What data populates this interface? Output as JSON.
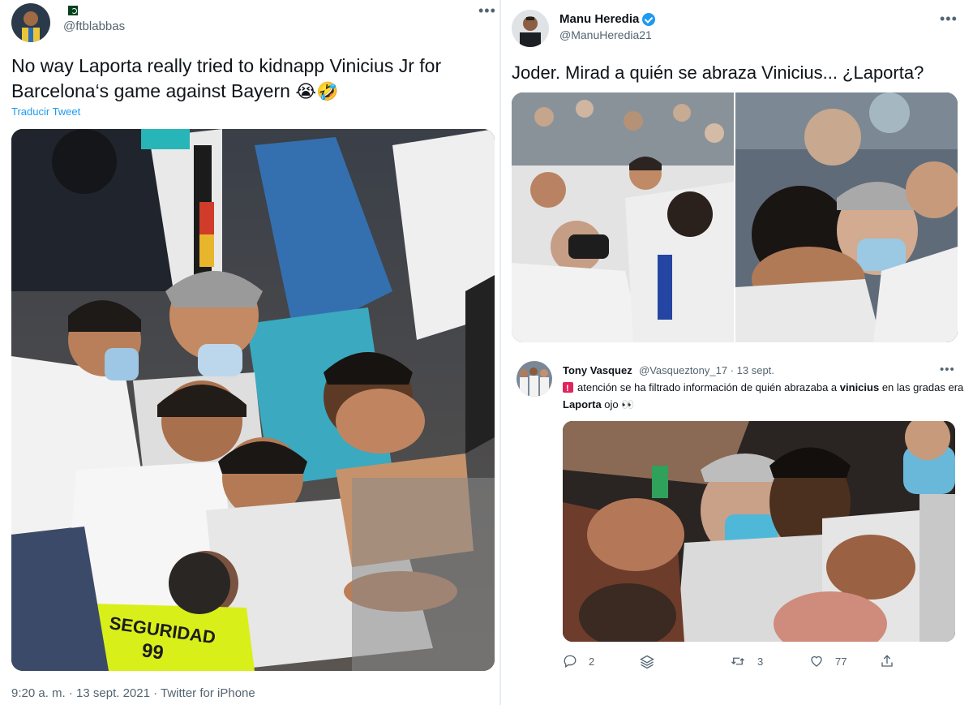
{
  "left_tweet": {
    "handle": "@ftblabbas",
    "flag": "pakistan-flag",
    "more_label": "•••",
    "text_line1": "No way Laporta really tried to kidnapp Vinicius Jr for",
    "text_line2": "Barcelona‘s game against Bayern",
    "emoji": "😭🤣",
    "translate_label": "Traducir Tweet",
    "vest_text_1": "SEGURIDAD",
    "vest_text_2": "99",
    "timestamp": "9:20 a. m. · 13 sept. 2021 · Twitter for iPhone"
  },
  "right_tweet": {
    "name": "Manu Heredia",
    "handle": "@ManuHeredia21",
    "more_label": "•••",
    "text": "Joder. Mirad a quién se abraza Vinicius... ¿Laporta?",
    "quote": {
      "name": "Tony Vasquez",
      "handle": "@Vasqueztony_17 · 13 sept.",
      "more_label": "•••",
      "text_part1": "atención se ha filtrado información de quién abrazaba a ",
      "text_bold1": "vinicius",
      "text_part2": " en las gradas era ",
      "text_bold2": "Laporta",
      "text_part3": " ojo 👀"
    },
    "actions": {
      "reply_count": "2",
      "retweet_count": "3",
      "like_count": "77"
    }
  },
  "colors": {
    "accent": "#1d9bf0",
    "secondary_text": "#536471",
    "seguridad_vest": "#d9ef1a"
  }
}
